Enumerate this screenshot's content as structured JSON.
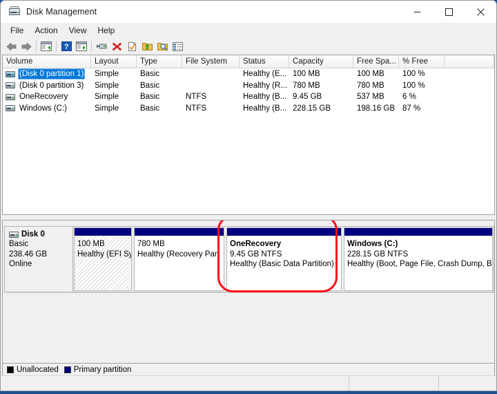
{
  "window": {
    "title": "Disk Management",
    "app_icon": "disk-drive-icon",
    "controls": {
      "minimize": "–",
      "maximize": "□",
      "close": "✕"
    }
  },
  "menubar": {
    "items": [
      "File",
      "Action",
      "View",
      "Help"
    ]
  },
  "toolbar": {
    "buttons": [
      "back-arrow-icon",
      "forward-arrow-icon",
      "separator",
      "up-one-level-icon",
      "separator",
      "help-icon",
      "show-hide-console-tree-icon",
      "separator",
      "properties-icon",
      "delete-icon",
      "refresh-icon",
      "export-list-icon",
      "find-icon",
      "details-icon"
    ]
  },
  "volume_list": {
    "columns": [
      "Volume",
      "Layout",
      "Type",
      "File System",
      "Status",
      "Capacity",
      "Free Spa...",
      "% Free",
      ""
    ],
    "rows": [
      {
        "icon": "drive-icon",
        "volume": "(Disk 0 partition 1)",
        "layout": "Simple",
        "type": "Basic",
        "file_system": "",
        "status": "Healthy (E...",
        "capacity": "100 MB",
        "free_space": "100 MB",
        "percent_free": "100 %",
        "selected": true
      },
      {
        "icon": "drive-icon",
        "volume": "(Disk 0 partition 3)",
        "layout": "Simple",
        "type": "Basic",
        "file_system": "",
        "status": "Healthy (R...",
        "capacity": "780 MB",
        "free_space": "780 MB",
        "percent_free": "100 %",
        "selected": false
      },
      {
        "icon": "drive-icon",
        "volume": "OneRecovery",
        "layout": "Simple",
        "type": "Basic",
        "file_system": "NTFS",
        "status": "Healthy (B...",
        "capacity": "9.45 GB",
        "free_space": "537 MB",
        "percent_free": "6 %",
        "selected": false
      },
      {
        "icon": "drive-icon",
        "volume": "Windows (C:)",
        "layout": "Simple",
        "type": "Basic",
        "file_system": "NTFS",
        "status": "Healthy (B...",
        "capacity": "228.15 GB",
        "free_space": "198.16 GB",
        "percent_free": "87 %",
        "selected": false
      }
    ]
  },
  "graphical_view": {
    "disk": {
      "icon": "drive-icon",
      "name": "Disk 0",
      "type": "Basic",
      "size": "238.46 GB",
      "status": "Online"
    },
    "partitions": [
      {
        "label": "",
        "size_fs": "100 MB",
        "health": "Healthy (EFI Sy",
        "style": "hatched",
        "bar_color": "#000080",
        "highlighted": false
      },
      {
        "label": "",
        "size_fs": "780 MB",
        "health": "Healthy (Recovery Par",
        "style": "plain",
        "bar_color": "#000080",
        "highlighted": false
      },
      {
        "label": "OneRecovery",
        "size_fs": "9.45 GB NTFS",
        "health": "Healthy (Basic Data Partition)",
        "style": "plain",
        "bar_color": "#000080",
        "highlighted": true
      },
      {
        "label": "Windows  (C:)",
        "size_fs": "228.15 GB NTFS",
        "health": "Healthy (Boot, Page File, Crash Dump, Basi",
        "style": "plain",
        "bar_color": "#000080",
        "highlighted": false
      }
    ],
    "annotation": {
      "shape": "rounded-rectangle",
      "color": "#fc0d1b"
    }
  },
  "legend": {
    "items": [
      {
        "label": "Unallocated",
        "color": "#000000"
      },
      {
        "label": "Primary partition",
        "color": "#000080"
      }
    ]
  },
  "statusbar": {
    "sections": [
      "",
      "",
      ""
    ]
  }
}
